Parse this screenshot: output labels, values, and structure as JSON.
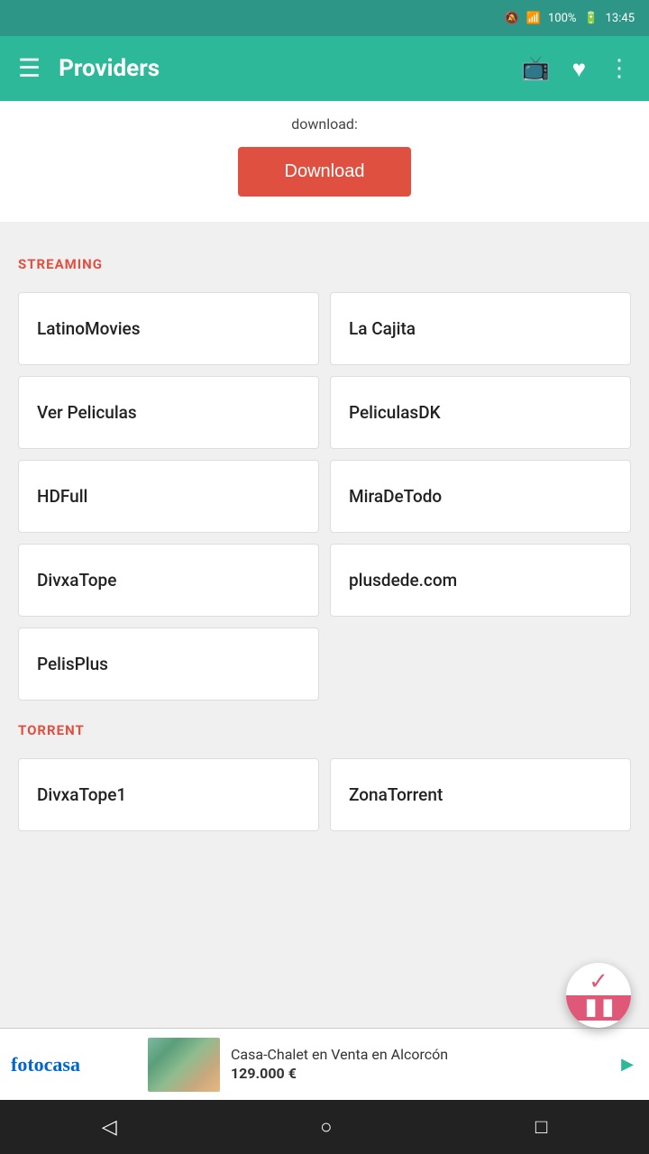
{
  "statusBar": {
    "time": "13:45",
    "battery": "100%",
    "signal": "📶"
  },
  "appBar": {
    "title": "Providers",
    "menuIcon": "menu",
    "tvIcon": "tv",
    "heartIcon": "heart",
    "moreIcon": "more"
  },
  "downloadSection": {
    "preText": "download:",
    "buttonLabel": "Download"
  },
  "streaming": {
    "sectionLabel": "STREAMING",
    "providers": [
      {
        "name": "LatinoMovies"
      },
      {
        "name": "La Cajita"
      },
      {
        "name": "Ver Peliculas"
      },
      {
        "name": "PeliculasDK"
      },
      {
        "name": "HDFull"
      },
      {
        "name": "MiraDeTodo"
      },
      {
        "name": "DivxaTope"
      },
      {
        "name": "plusdede.com"
      },
      {
        "name": "PelisPlus"
      }
    ]
  },
  "torrent": {
    "sectionLabel": "TORRENT",
    "providers": [
      {
        "name": "DivxaTope1"
      },
      {
        "name": "ZonaTorrent"
      }
    ]
  },
  "ad": {
    "brand": "fotocasa",
    "title": "Casa-Chalet en Venta en Alcorcón",
    "price": "129.000 €"
  },
  "navBar": {
    "backIcon": "◁",
    "homeIcon": "○",
    "recentsIcon": "□"
  }
}
